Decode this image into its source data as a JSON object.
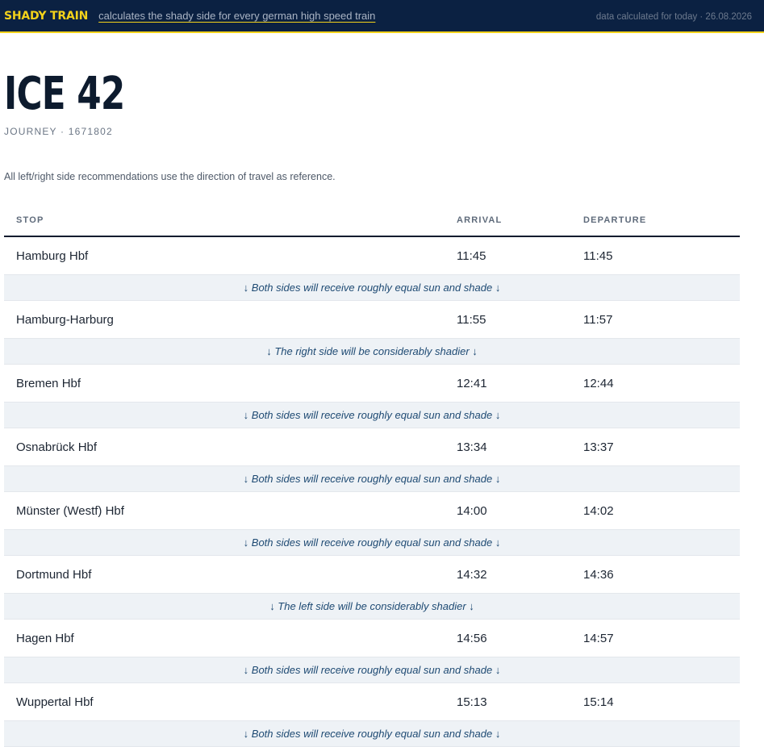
{
  "header": {
    "brand": "SHADY TRAIN",
    "tagline": "calculates the shady side for every german high speed train",
    "data_info": "data calculated for today · 26.08.2026"
  },
  "train": {
    "name": "ICE 42",
    "journey": "JOURNEY · 1671802"
  },
  "note": "All left/right side recommendations use the direction of travel as reference.",
  "table": {
    "columns": [
      "STOP",
      "ARRIVAL",
      "DEPARTURE"
    ],
    "rows": [
      {
        "stop": "Hamburg Hbf",
        "arrival": "11:45",
        "departure": "11:45",
        "shade": "↓ Both sides will receive roughly equal sun and shade ↓"
      },
      {
        "stop": "Hamburg-Harburg",
        "arrival": "11:55",
        "departure": "11:57",
        "shade": "↓ The right side will be considerably shadier ↓"
      },
      {
        "stop": "Bremen Hbf",
        "arrival": "12:41",
        "departure": "12:44",
        "shade": "↓ Both sides will receive roughly equal sun and shade ↓"
      },
      {
        "stop": "Osnabrück Hbf",
        "arrival": "13:34",
        "departure": "13:37",
        "shade": "↓ Both sides will receive roughly equal sun and shade ↓"
      },
      {
        "stop": "Münster (Westf) Hbf",
        "arrival": "14:00",
        "departure": "14:02",
        "shade": "↓ Both sides will receive roughly equal sun and shade ↓"
      },
      {
        "stop": "Dortmund Hbf",
        "arrival": "14:32",
        "departure": "14:36",
        "shade": "↓ The left side will be considerably shadier ↓"
      },
      {
        "stop": "Hagen Hbf",
        "arrival": "14:56",
        "departure": "14:57",
        "shade": "↓ Both sides will receive roughly equal sun and shade ↓"
      },
      {
        "stop": "Wuppertal Hbf",
        "arrival": "15:13",
        "departure": "15:14",
        "shade": "↓ Both sides will receive roughly equal sun and shade ↓"
      }
    ]
  },
  "colors": {
    "header_bg": "#0b2142",
    "accent_yellow": "#f3d21a",
    "shade_row_bg": "#eef2f6",
    "shade_text": "#1e4a73"
  }
}
